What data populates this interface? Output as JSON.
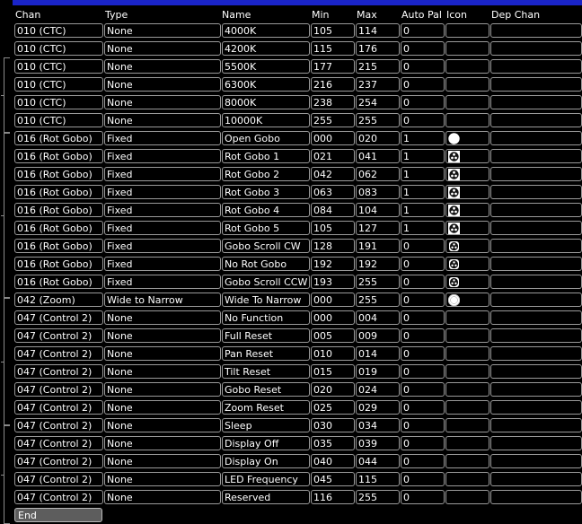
{
  "header": {
    "chan": "Chan",
    "type": "Type",
    "name": "Name",
    "min": "Min",
    "max": "Max",
    "auto_pal": "Auto Pal",
    "icon": "Icon",
    "dep_chan": "Dep Chan"
  },
  "rows": [
    {
      "chan": "010 (CTC)",
      "type": "None",
      "name": "4000K",
      "min": "105",
      "max": "114",
      "auto": "0",
      "icon": ""
    },
    {
      "chan": "010 (CTC)",
      "type": "None",
      "name": "4200K",
      "min": "115",
      "max": "176",
      "auto": "0",
      "icon": ""
    },
    {
      "chan": "010 (CTC)",
      "type": "None",
      "name": "5500K",
      "min": "177",
      "max": "215",
      "auto": "0",
      "icon": ""
    },
    {
      "chan": "010 (CTC)",
      "type": "None",
      "name": "6300K",
      "min": "216",
      "max": "237",
      "auto": "0",
      "icon": ""
    },
    {
      "chan": "010 (CTC)",
      "type": "None",
      "name": "8000K",
      "min": "238",
      "max": "254",
      "auto": "0",
      "icon": ""
    },
    {
      "chan": "010 (CTC)",
      "type": "None",
      "name": "10000K",
      "min": "255",
      "max": "255",
      "auto": "0",
      "icon": ""
    },
    {
      "chan": "016 (Rot Gobo)",
      "type": "Fixed",
      "name": "Open Gobo",
      "min": "000",
      "max": "020",
      "auto": "1",
      "icon": "open-gobo-icon"
    },
    {
      "chan": "016 (Rot Gobo)",
      "type": "Fixed",
      "name": "Rot Gobo 1",
      "min": "021",
      "max": "041",
      "auto": "1",
      "icon": "gobo-pattern-icon"
    },
    {
      "chan": "016 (Rot Gobo)",
      "type": "Fixed",
      "name": "Rot Gobo 2",
      "min": "042",
      "max": "062",
      "auto": "1",
      "icon": "gobo-pattern-icon"
    },
    {
      "chan": "016 (Rot Gobo)",
      "type": "Fixed",
      "name": "Rot Gobo 3",
      "min": "063",
      "max": "083",
      "auto": "1",
      "icon": "gobo-pattern-icon"
    },
    {
      "chan": "016 (Rot Gobo)",
      "type": "Fixed",
      "name": "Rot Gobo 4",
      "min": "084",
      "max": "104",
      "auto": "1",
      "icon": "gobo-pattern-icon"
    },
    {
      "chan": "016 (Rot Gobo)",
      "type": "Fixed",
      "name": "Rot Gobo 5",
      "min": "105",
      "max": "127",
      "auto": "1",
      "icon": "gobo-pattern-icon"
    },
    {
      "chan": "016 (Rot Gobo)",
      "type": "Fixed",
      "name": "Gobo Scroll CW",
      "min": "128",
      "max": "191",
      "auto": "0",
      "icon": "gobo-scroll-icon"
    },
    {
      "chan": "016 (Rot Gobo)",
      "type": "Fixed",
      "name": "No Rot Gobo",
      "min": "192",
      "max": "192",
      "auto": "0",
      "icon": "gobo-scroll-icon"
    },
    {
      "chan": "016 (Rot Gobo)",
      "type": "Fixed",
      "name": "Gobo Scroll CCW",
      "min": "193",
      "max": "255",
      "auto": "0",
      "icon": "gobo-scroll-icon"
    },
    {
      "chan": "042 (Zoom)",
      "type": "Wide to Narrow",
      "name": "Wide To Narrow",
      "min": "000",
      "max": "255",
      "auto": "0",
      "icon": "zoom-icon"
    },
    {
      "chan": "047 (Control 2)",
      "type": "None",
      "name": "No Function",
      "min": "000",
      "max": "004",
      "auto": "0",
      "icon": ""
    },
    {
      "chan": "047 (Control 2)",
      "type": "None",
      "name": "Full Reset",
      "min": "005",
      "max": "009",
      "auto": "0",
      "icon": ""
    },
    {
      "chan": "047 (Control 2)",
      "type": "None",
      "name": "Pan Reset",
      "min": "010",
      "max": "014",
      "auto": "0",
      "icon": ""
    },
    {
      "chan": "047 (Control 2)",
      "type": "None",
      "name": "Tilt Reset",
      "min": "015",
      "max": "019",
      "auto": "0",
      "icon": ""
    },
    {
      "chan": "047 (Control 2)",
      "type": "None",
      "name": "Gobo Reset",
      "min": "020",
      "max": "024",
      "auto": "0",
      "icon": ""
    },
    {
      "chan": "047 (Control 2)",
      "type": "None",
      "name": "Zoom Reset",
      "min": "025",
      "max": "029",
      "auto": "0",
      "icon": ""
    },
    {
      "chan": "047 (Control 2)",
      "type": "None",
      "name": "Sleep",
      "min": "030",
      "max": "034",
      "auto": "0",
      "icon": ""
    },
    {
      "chan": "047 (Control 2)",
      "type": "None",
      "name": "Display Off",
      "min": "035",
      "max": "039",
      "auto": "0",
      "icon": ""
    },
    {
      "chan": "047 (Control 2)",
      "type": "None",
      "name": "Display On",
      "min": "040",
      "max": "044",
      "auto": "0",
      "icon": ""
    },
    {
      "chan": "047 (Control 2)",
      "type": "None",
      "name": "LED Frequency",
      "min": "045",
      "max": "115",
      "auto": "0",
      "icon": ""
    },
    {
      "chan": "047 (Control 2)",
      "type": "None",
      "name": "Reserved",
      "min": "116",
      "max": "255",
      "auto": "0",
      "icon": ""
    }
  ],
  "end_label": "End",
  "colors": {
    "title_bar": "#1a24c8",
    "cell_border": "#9a9a9a",
    "end_bg": "#5d5d5d"
  }
}
